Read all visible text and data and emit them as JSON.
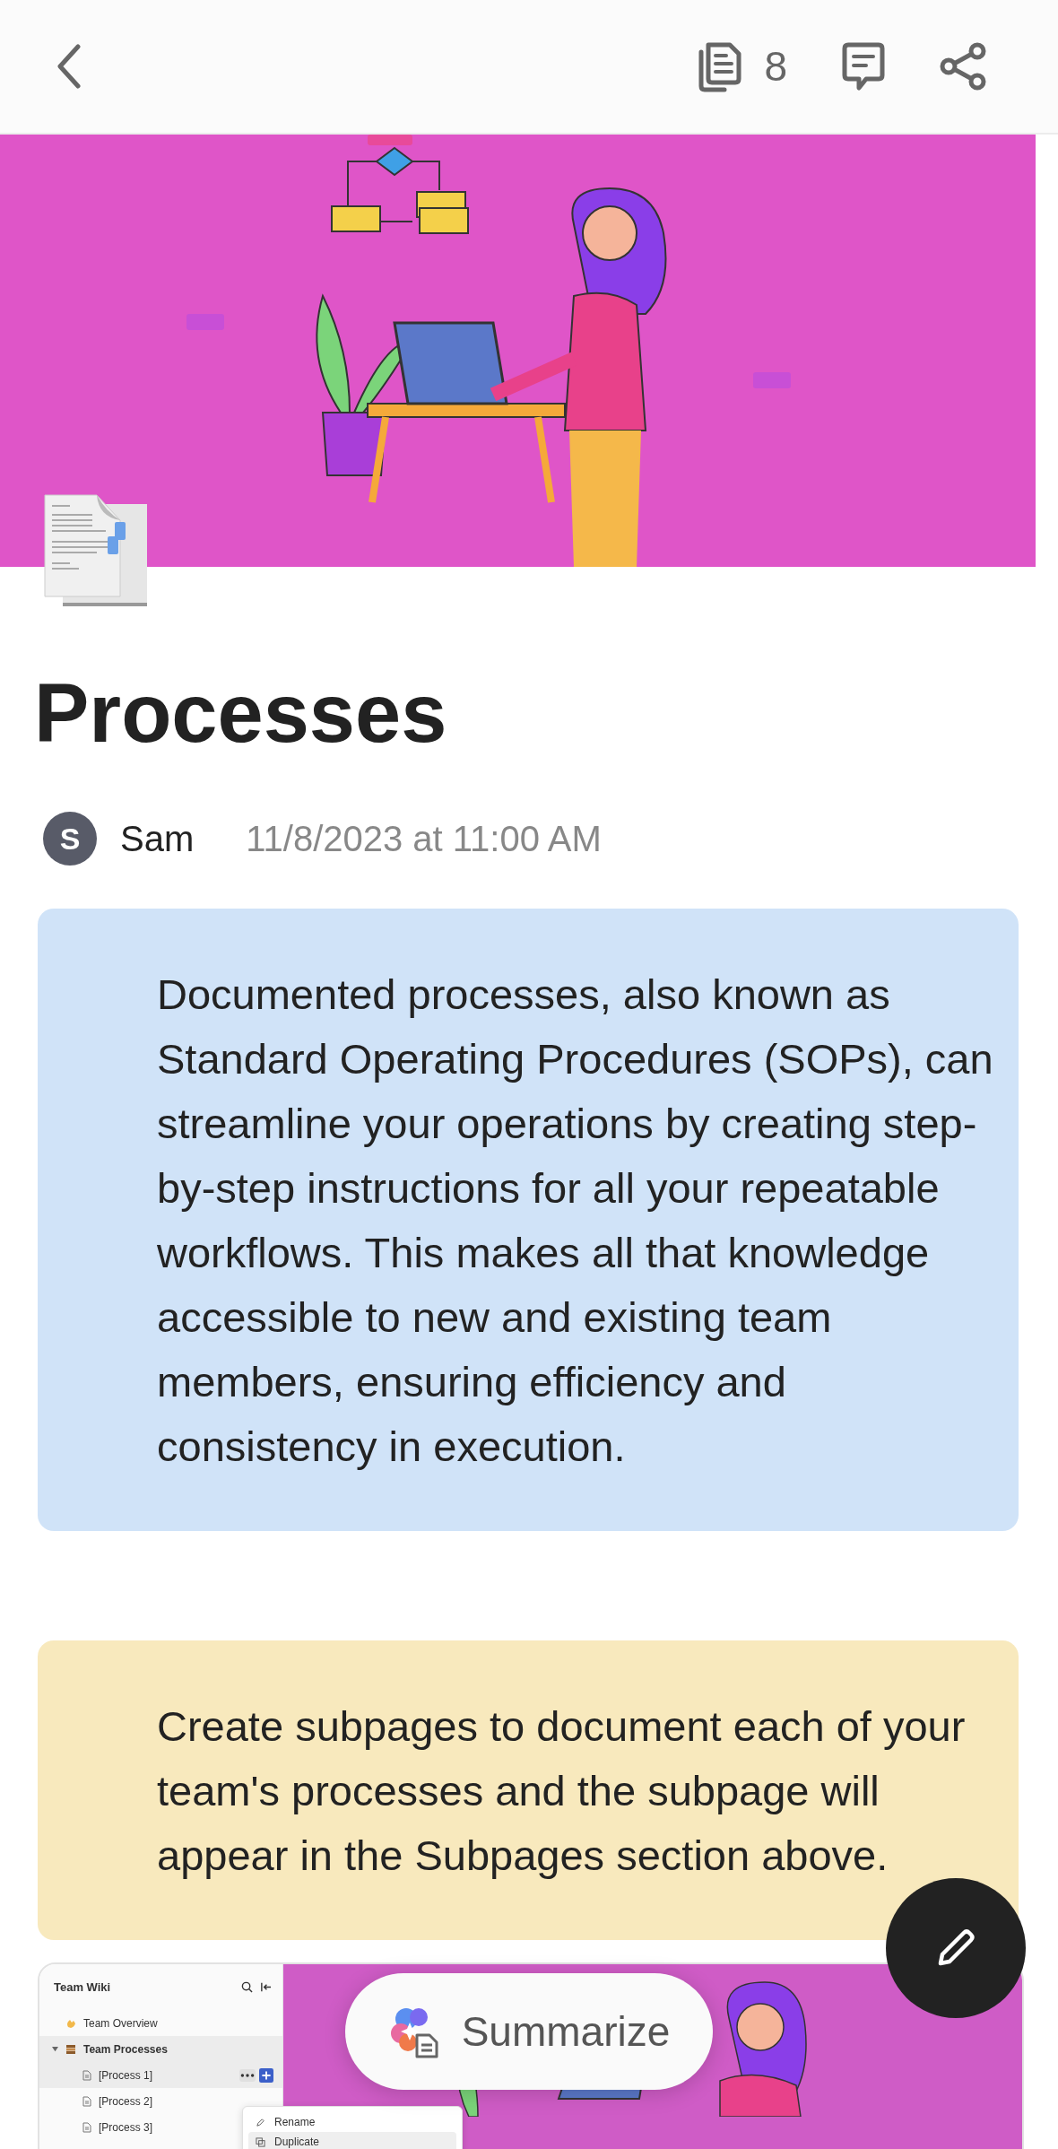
{
  "top_bar": {
    "subpage_count": "8"
  },
  "page": {
    "title": "Processes",
    "author": {
      "initial": "S",
      "name": "Sam"
    },
    "timestamp": "11/8/2023 at 11:00 AM"
  },
  "callouts": [
    {
      "color": "#d0e3f8",
      "text": "Documented processes, also known as Standard Operating Procedures (SOPs), can streamline your operations by creating step-by-step instructions for all your repeatable workflows. This makes all that knowledge accessible to new and existing team members, ensuring efficiency and consistency in execution."
    },
    {
      "color": "#f8e9bd",
      "text": "Create subpages to document each of your team's processes and the subpage will appear in the Subpages section above."
    }
  ],
  "embedded_screenshot": {
    "sidebar_title": "Team Wiki",
    "items": [
      {
        "label": "Team Overview",
        "kind": "wave",
        "selected": false
      },
      {
        "label": "Team Processes",
        "kind": "books",
        "selected": true,
        "expanded": true,
        "children": [
          {
            "label": "[Process 1]",
            "selected": true
          },
          {
            "label": "[Process 2]",
            "selected": false
          },
          {
            "label": "[Process 3]",
            "selected": false
          }
        ]
      }
    ],
    "context_menu": [
      {
        "label": "Rename",
        "kind": "pencil",
        "selected": false
      },
      {
        "label": "Duplicate",
        "kind": "copy",
        "selected": true
      }
    ]
  },
  "summarize_button": {
    "label": "Summarize"
  }
}
